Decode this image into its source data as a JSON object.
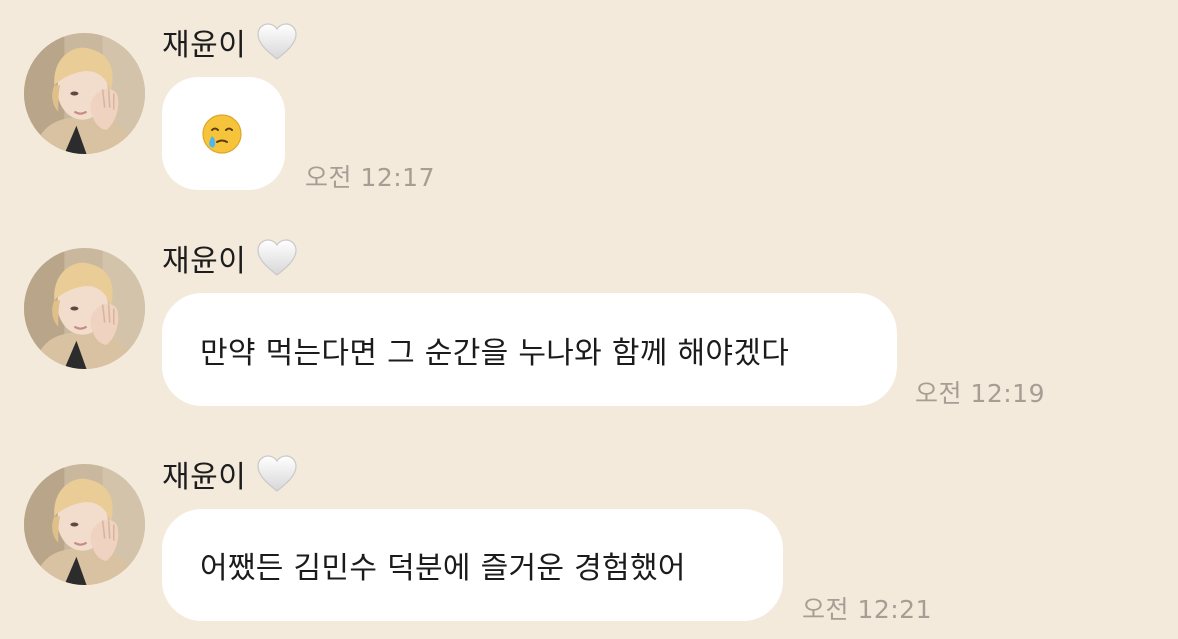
{
  "colors": {
    "background": "#f3eadb",
    "bubble": "#ffffff",
    "timestamp": "#a59e94",
    "text": "#1b1b1b"
  },
  "messages": [
    {
      "sender": "재윤이",
      "sender_icon": "white-heart-icon",
      "content_type": "emoji",
      "emoji": "face-holding-back-tears-icon",
      "text": "",
      "time": "오전 12:17"
    },
    {
      "sender": "재윤이",
      "sender_icon": "white-heart-icon",
      "content_type": "text",
      "text": "만약 먹는다면 그 순간을 누나와 함께 해야겠다",
      "time": "오전 12:19"
    },
    {
      "sender": "재윤이",
      "sender_icon": "white-heart-icon",
      "content_type": "text",
      "text": "어쨌든 김민수 덕분에 즐거운 경험했어",
      "time": "오전 12:21"
    }
  ]
}
